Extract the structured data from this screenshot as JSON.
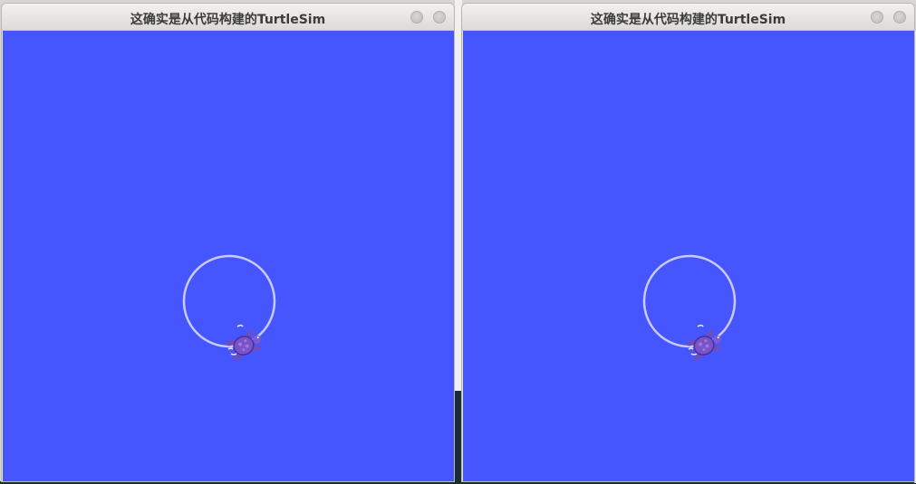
{
  "windows": [
    {
      "title": "这确实是从代码构建的TurtleSim",
      "buttons": [
        "minimize-button",
        "close-button"
      ],
      "canvas": {
        "background_color": "#4556ff",
        "trail_color": "#c9cbff",
        "trail_shape": "circle",
        "turtle_icon": "turtle-icon"
      }
    },
    {
      "title": "这确实是从代码构建的TurtleSim",
      "buttons": [
        "minimize-button",
        "close-button"
      ],
      "canvas": {
        "background_color": "#4556ff",
        "trail_color": "#c9cbff",
        "trail_shape": "circle",
        "turtle_icon": "turtle-icon"
      }
    }
  ]
}
